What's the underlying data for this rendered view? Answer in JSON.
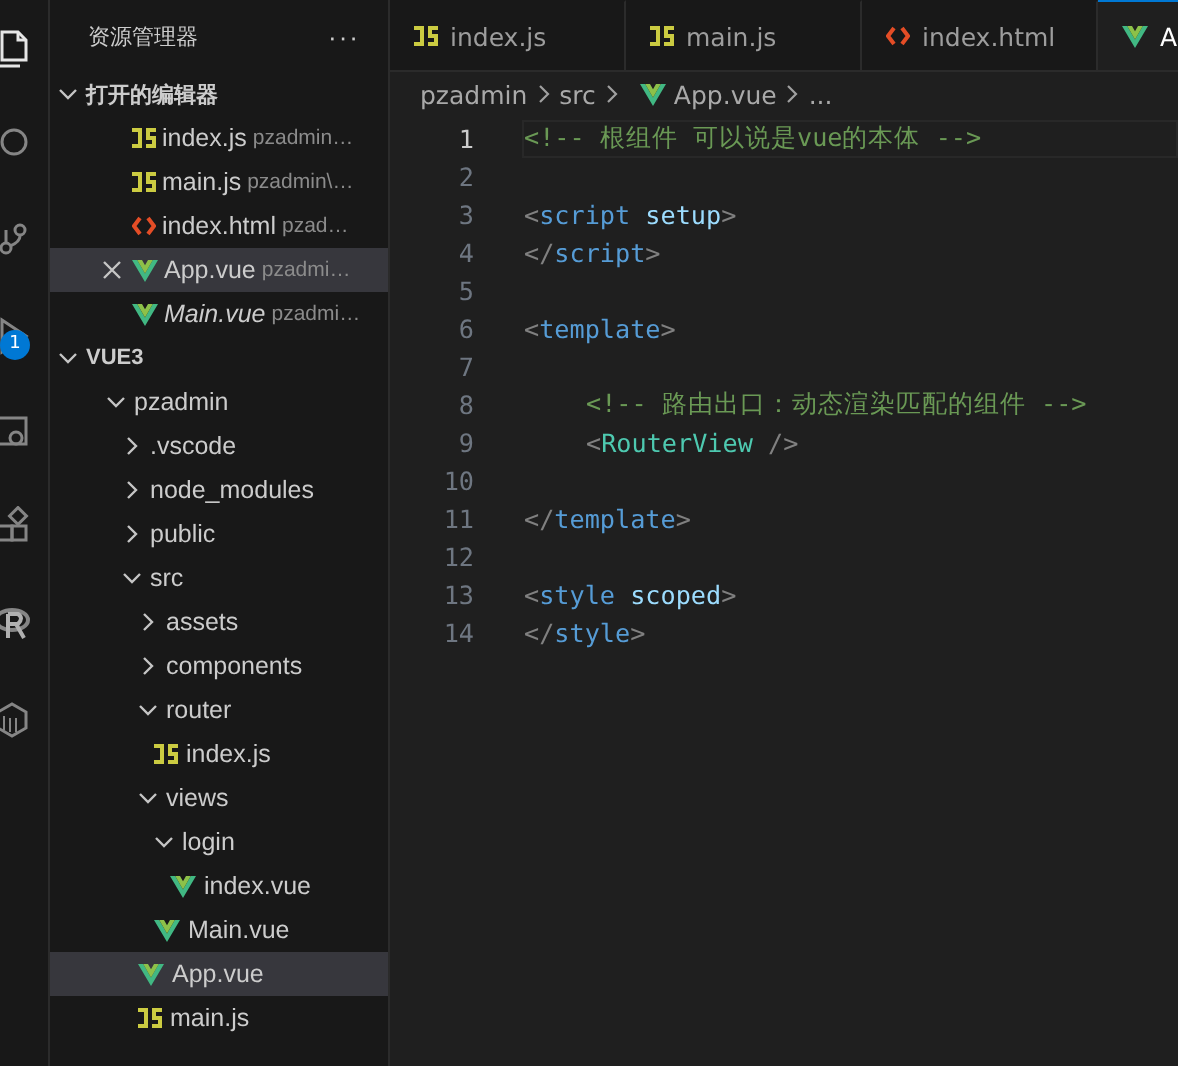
{
  "activity_bar": [
    {
      "kind": "files",
      "selected": true
    },
    {
      "kind": "search",
      "selected": false
    },
    {
      "kind": "source",
      "selected": false
    },
    {
      "kind": "debug",
      "selected": false,
      "badge": "1"
    },
    {
      "kind": "remote",
      "selected": false
    },
    {
      "kind": "extensions",
      "selected": false
    },
    {
      "kind": "r",
      "selected": false
    },
    {
      "kind": "box",
      "selected": false
    }
  ],
  "sidebar": {
    "title": "资源管理器",
    "more": "···",
    "open_editors": {
      "title": "打开的编辑器",
      "expanded": true,
      "items": [
        {
          "name": "index.js",
          "path": "pzadmin…",
          "kind": "js",
          "selected": false
        },
        {
          "name": "main.js",
          "path": "pzadmin\\…",
          "kind": "js",
          "selected": false
        },
        {
          "name": "index.html",
          "path": "pzad…",
          "kind": "html",
          "selected": false
        },
        {
          "name": "App.vue",
          "path": "pzadmi…",
          "kind": "vue",
          "selected": true,
          "close": true
        },
        {
          "name": "Main.vue",
          "path": "pzadmi…",
          "kind": "vue",
          "selected": false,
          "preview": true
        }
      ]
    },
    "workspace": {
      "title": "VUE3",
      "expanded": true,
      "tree": [
        {
          "label": "pzadmin",
          "kind": "folder",
          "expanded": true,
          "selected": false,
          "children": [
            {
              "label": ".vscode",
              "kind": "folder",
              "expanded": false,
              "selected": false
            },
            {
              "label": "node_modules",
              "kind": "folder",
              "expanded": false,
              "selected": false
            },
            {
              "label": "public",
              "kind": "folder",
              "expanded": false,
              "selected": false
            },
            {
              "label": "src",
              "kind": "folder",
              "expanded": true,
              "selected": false,
              "children": [
                {
                  "label": "assets",
                  "kind": "folder",
                  "expanded": false,
                  "selected": false
                },
                {
                  "label": "components",
                  "kind": "folder",
                  "expanded": false,
                  "selected": false
                },
                {
                  "label": "router",
                  "kind": "folder",
                  "expanded": true,
                  "selected": false,
                  "children": [
                    {
                      "label": "index.js",
                      "kind": "js",
                      "selected": false
                    }
                  ]
                },
                {
                  "label": "views",
                  "kind": "folder",
                  "expanded": true,
                  "selected": false,
                  "children": [
                    {
                      "label": "login",
                      "kind": "folder",
                      "expanded": true,
                      "selected": false,
                      "children": [
                        {
                          "label": "index.vue",
                          "kind": "vue",
                          "selected": false
                        }
                      ]
                    },
                    {
                      "label": "Main.vue",
                      "kind": "vue",
                      "selected": false
                    }
                  ]
                },
                {
                  "label": "App.vue",
                  "kind": "vue",
                  "selected": true
                },
                {
                  "label": "main.js",
                  "kind": "js",
                  "selected": false
                }
              ]
            }
          ]
        }
      ]
    }
  },
  "tabs": [
    {
      "label": "index.js",
      "kind": "js",
      "selected": false
    },
    {
      "label": "main.js",
      "kind": "js",
      "selected": false
    },
    {
      "label": "index.html",
      "kind": "html",
      "selected": false
    },
    {
      "label": "A",
      "kind": "vue",
      "selected": true
    }
  ],
  "breadcrumb": [
    {
      "label": "pzadmin",
      "kind": "text"
    },
    {
      "label": "src",
      "kind": "text"
    },
    {
      "label": "App.vue",
      "kind": "vue"
    },
    {
      "label": "...",
      "kind": "text"
    }
  ],
  "code": [
    {
      "number": "1",
      "current": true,
      "tokens": [
        {
          "kind": "comment",
          "text": "<!-- 根组件 可以说是vue的本体 -->"
        }
      ]
    },
    {
      "number": "2",
      "current": false
    },
    {
      "number": "3",
      "current": false,
      "tokens": [
        {
          "kind": "punct",
          "text": "<"
        },
        {
          "kind": "tag",
          "text": "script"
        },
        {
          "kind": "attr",
          "text": " setup"
        },
        {
          "kind": "punct",
          "text": ">"
        }
      ]
    },
    {
      "number": "4",
      "current": false,
      "tokens": [
        {
          "kind": "punct",
          "text": "</"
        },
        {
          "kind": "tag",
          "text": "script"
        },
        {
          "kind": "punct",
          "text": ">"
        }
      ]
    },
    {
      "number": "5",
      "current": false
    },
    {
      "number": "6",
      "current": false,
      "tokens": [
        {
          "kind": "punct",
          "text": "<"
        },
        {
          "kind": "tag",
          "text": "template"
        },
        {
          "kind": "punct",
          "text": ">"
        }
      ]
    },
    {
      "number": "7",
      "current": false
    },
    {
      "number": "8",
      "current": false,
      "indented": true,
      "tokens": [
        {
          "kind": "comment",
          "text": "<!-- 路由出口：动态渲染匹配的组件 -->"
        }
      ]
    },
    {
      "number": "9",
      "current": false,
      "indented": true,
      "tokens": [
        {
          "kind": "punct",
          "text": "<"
        },
        {
          "kind": "component",
          "text": "RouterView"
        },
        {
          "kind": "punct",
          "text": " />"
        }
      ]
    },
    {
      "number": "10",
      "current": false
    },
    {
      "number": "11",
      "current": false,
      "tokens": [
        {
          "kind": "punct",
          "text": "</"
        },
        {
          "kind": "tag",
          "text": "template"
        },
        {
          "kind": "punct",
          "text": ">"
        }
      ]
    },
    {
      "number": "12",
      "current": false
    },
    {
      "number": "13",
      "current": false,
      "tokens": [
        {
          "kind": "punct",
          "text": "<"
        },
        {
          "kind": "tag",
          "text": "style"
        },
        {
          "kind": "attr",
          "text": " scoped"
        },
        {
          "kind": "punct",
          "text": ">"
        }
      ]
    },
    {
      "number": "14",
      "current": false,
      "tokens": [
        {
          "kind": "punct",
          "text": "</"
        },
        {
          "kind": "tag",
          "text": "style"
        },
        {
          "kind": "punct",
          "text": ">"
        }
      ]
    }
  ]
}
